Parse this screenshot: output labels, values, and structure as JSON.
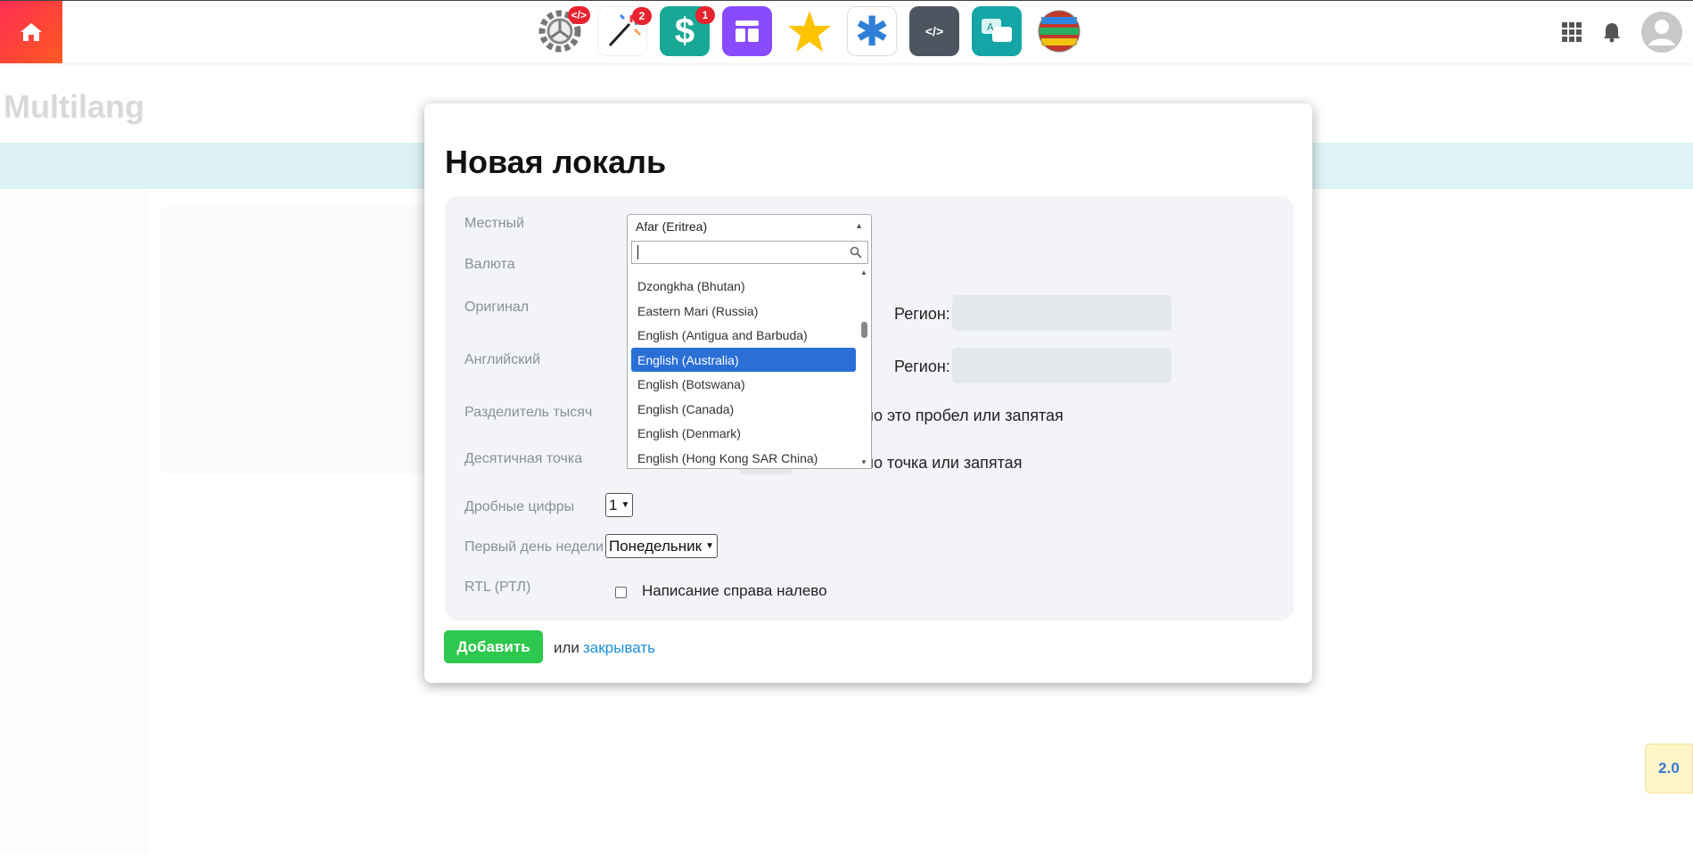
{
  "topbar": {
    "apps": [
      {
        "icon": "gear-code-icon",
        "badge": ""
      },
      {
        "icon": "magic-wand-icon",
        "badge": "2"
      },
      {
        "icon": "dollar-icon",
        "badge": "1"
      },
      {
        "icon": "layout-icon",
        "badge": ""
      },
      {
        "icon": "star-person-icon",
        "badge": ""
      },
      {
        "icon": "asterisk-icon",
        "badge": ""
      },
      {
        "icon": "code-book-icon",
        "badge": ""
      },
      {
        "icon": "translate-icon",
        "badge": ""
      },
      {
        "icon": "globe-flags-icon",
        "badge": ""
      }
    ]
  },
  "background": {
    "title": "Multilang"
  },
  "modal": {
    "title": "Новая локаль",
    "labels": {
      "locale": "Местный",
      "currency": "Валюта",
      "original": "Оригинал",
      "english": "Английский",
      "thousands": "Разделитель тысяч",
      "decimal": "Десятичная точка",
      "fraction": "Дробные цифры",
      "first_day": "Первый день недели",
      "rtl": "RTL (РТЛ)"
    },
    "region_label": "Регион:",
    "thousands_hint": "но это пробел или запятая",
    "decimal_hint": "но точка или запятая",
    "fraction_value": "1",
    "first_day_value": "Понедельник",
    "rtl_text": "Написание справа налево",
    "add_button": "Добавить",
    "or_text": "или",
    "close_link": "закрывать"
  },
  "dropdown": {
    "selected": "Afar (Eritrea)",
    "search_value": "",
    "options": [
      "Dzongkha (Bhutan)",
      "Eastern Mari (Russia)",
      "English (Antigua and Barbuda)",
      "English (Australia)",
      "English (Botswana)",
      "English (Canada)",
      "English (Denmark)",
      "English (Hong Kong SAR China)"
    ],
    "highlighted": "English (Australia)"
  },
  "version_badge": "2.0",
  "colors": {
    "home": "#ff2d55",
    "add_button": "#2dc84d",
    "link": "#1b8fd8",
    "highlight": "#2a6fd6"
  }
}
